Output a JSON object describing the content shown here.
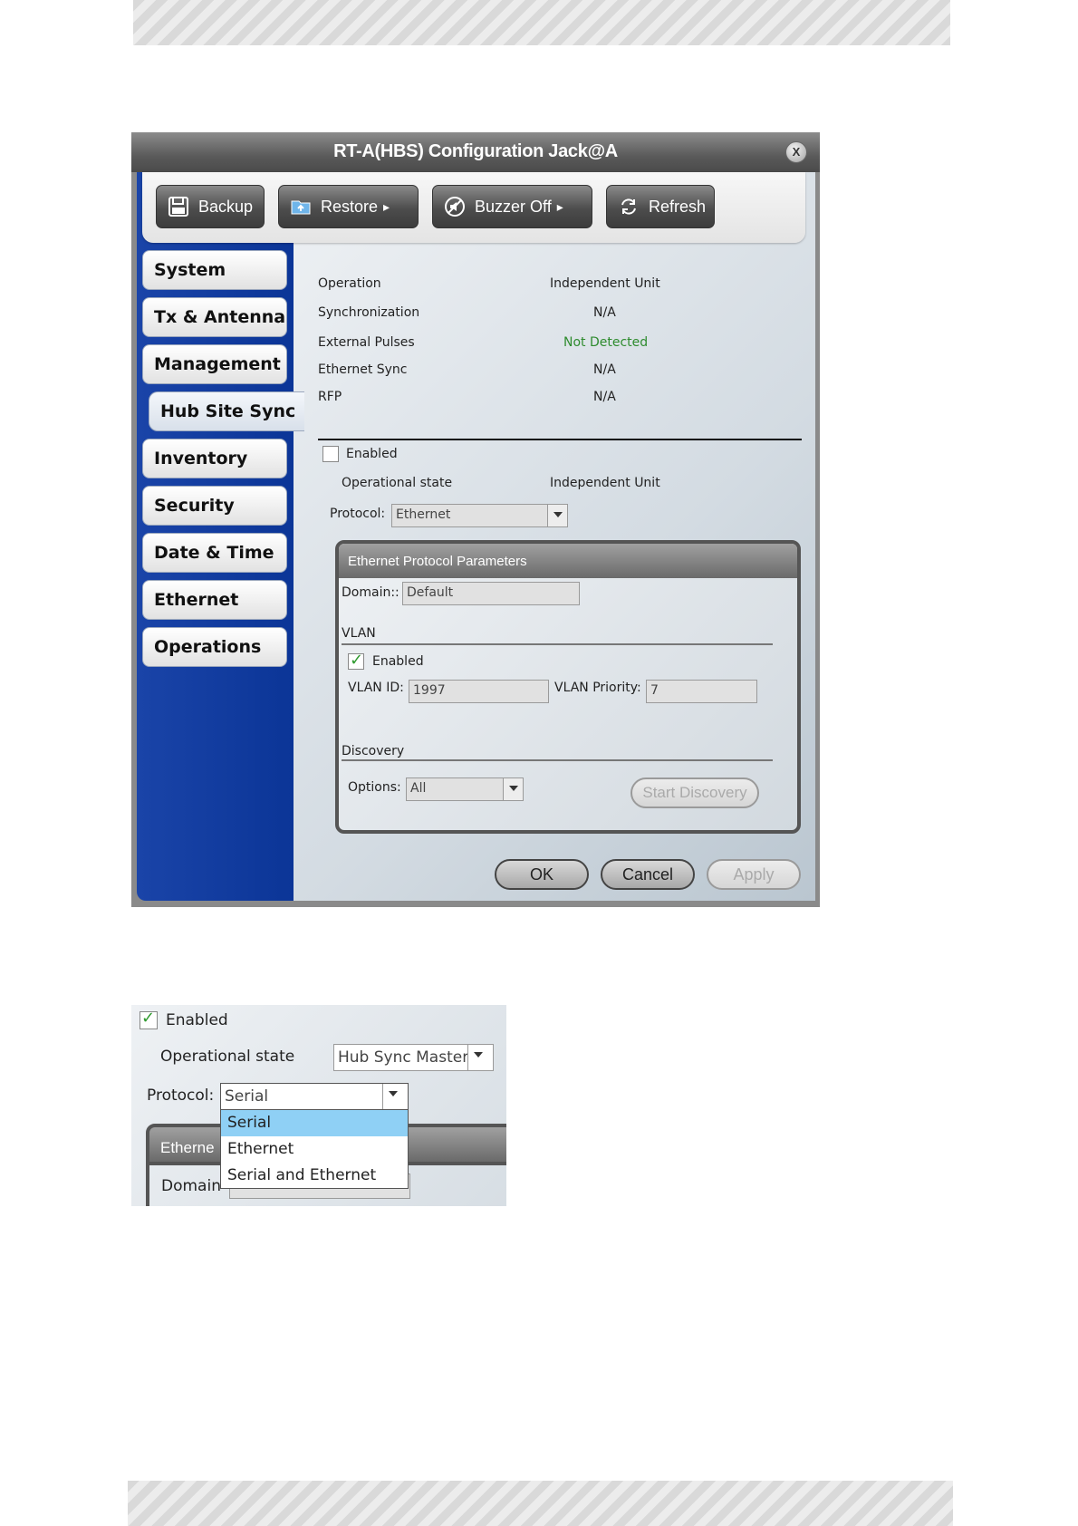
{
  "window": {
    "title": "RT-A(HBS) Configuration Jack@A",
    "close_label": "X"
  },
  "toolbar": {
    "backup": "Backup",
    "restore": "Restore",
    "buzzer_off": "Buzzer Off",
    "refresh": "Refresh",
    "submenu_arrow": "▸"
  },
  "nav": {
    "items": [
      "System",
      "Tx & Antenna",
      "Management",
      "Hub Site Sync",
      "Inventory",
      "Security",
      "Date & Time",
      "Ethernet",
      "Operations"
    ],
    "active": "Hub Site Sync"
  },
  "status": {
    "rows": [
      {
        "label": "Operation",
        "value": "Independent Unit"
      },
      {
        "label": "Synchronization",
        "value": "N/A"
      },
      {
        "label": "External Pulses",
        "value": "Not Detected"
      },
      {
        "label": "Ethernet Sync",
        "value": "N/A"
      },
      {
        "label": "RFP",
        "value": "N/A"
      }
    ],
    "not_detected_color": "#2e8b2e"
  },
  "hss": {
    "enabled_label": "Enabled",
    "enabled": false,
    "op_state_label": "Operational state",
    "op_state_value": "Independent Unit",
    "protocol_label": "Protocol:",
    "protocol_value": "Ethernet"
  },
  "eth_params": {
    "header": "Ethernet Protocol Parameters",
    "domain_label": "Domain::",
    "domain_value": "Default",
    "vlan_section": "VLAN",
    "vlan_enabled_label": "Enabled",
    "vlan_enabled": true,
    "vlan_id_label": "VLAN ID:",
    "vlan_id_value": "1997",
    "vlan_priority_label": "VLAN Priority:",
    "vlan_priority_value": "7",
    "discovery_section": "Discovery",
    "options_label": "Options:",
    "options_value": "All",
    "start_discovery": "Start Discovery"
  },
  "footer": {
    "ok": "OK",
    "cancel": "Cancel",
    "apply": "Apply"
  },
  "snippet": {
    "enabled_label": "Enabled",
    "enabled": true,
    "op_state_label": "Operational state",
    "op_state_value": "Hub Sync Master",
    "protocol_label": "Protocol:",
    "protocol_value": "Serial",
    "options": [
      "Serial",
      "Ethernet",
      "Serial and Ethernet"
    ],
    "selected": "Serial",
    "partial_header": "Etherne",
    "partial_domain": "Domain"
  }
}
